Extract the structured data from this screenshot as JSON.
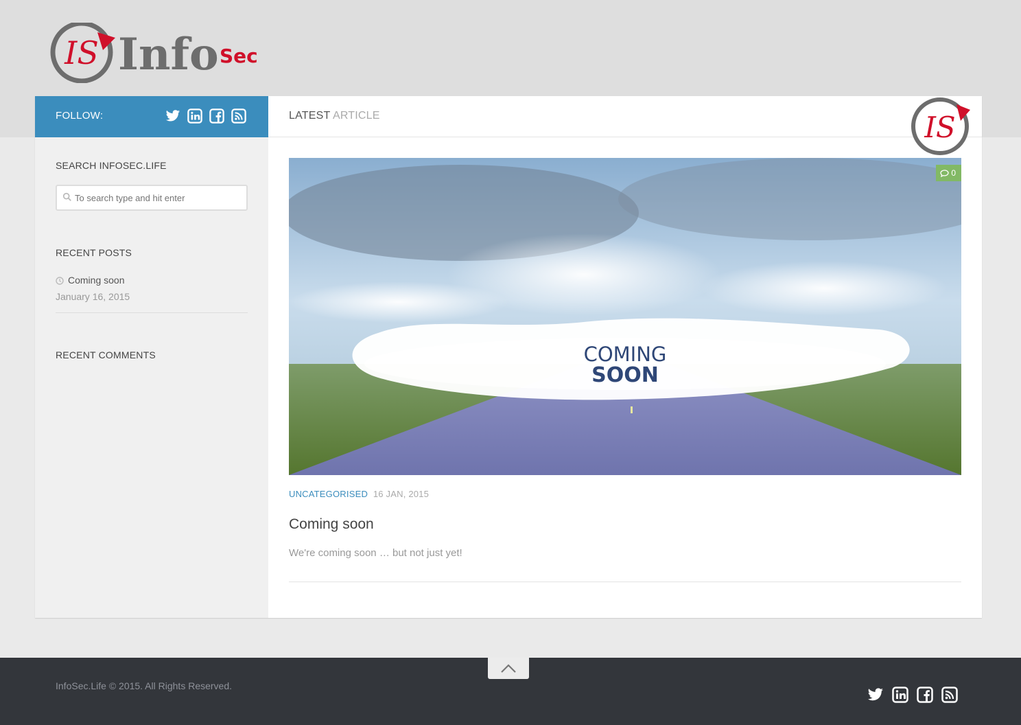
{
  "site": {
    "logo_main": "Info",
    "logo_accent": "Sec",
    "logo_mark": "IS"
  },
  "colors": {
    "accent_blue": "#3b8dbd",
    "brand_red": "#d0102a",
    "logo_gray": "#6d6d6d",
    "comment_green": "#82b965",
    "footer_bg": "#33363b"
  },
  "sidebar": {
    "follow_label": "Follow:",
    "social_icons": [
      "twitter-icon",
      "linkedin-icon",
      "facebook-icon",
      "rss-icon"
    ],
    "search_title": "Search InfoSec.Life",
    "search_placeholder": "To search type and hit enter",
    "recent_posts_title": "Recent Posts",
    "recent_posts": [
      {
        "title": "Coming soon",
        "date": "January 16, 2015"
      }
    ],
    "recent_comments_title": "Recent Comments"
  },
  "main": {
    "header_part1": "Latest",
    "header_part2": "Article",
    "post": {
      "image_text_line1": "COMING",
      "image_text_line2": "SOON",
      "comment_count": "0",
      "category": "Uncategorised",
      "date": "16 Jan, 2015",
      "title": "Coming soon",
      "excerpt": "We're coming soon … but not just yet!"
    }
  },
  "footer": {
    "copyright": "InfoSec.Life © 2015. All Rights Reserved.",
    "social_icons": [
      "twitter-icon",
      "linkedin-icon",
      "facebook-icon",
      "rss-icon"
    ]
  }
}
